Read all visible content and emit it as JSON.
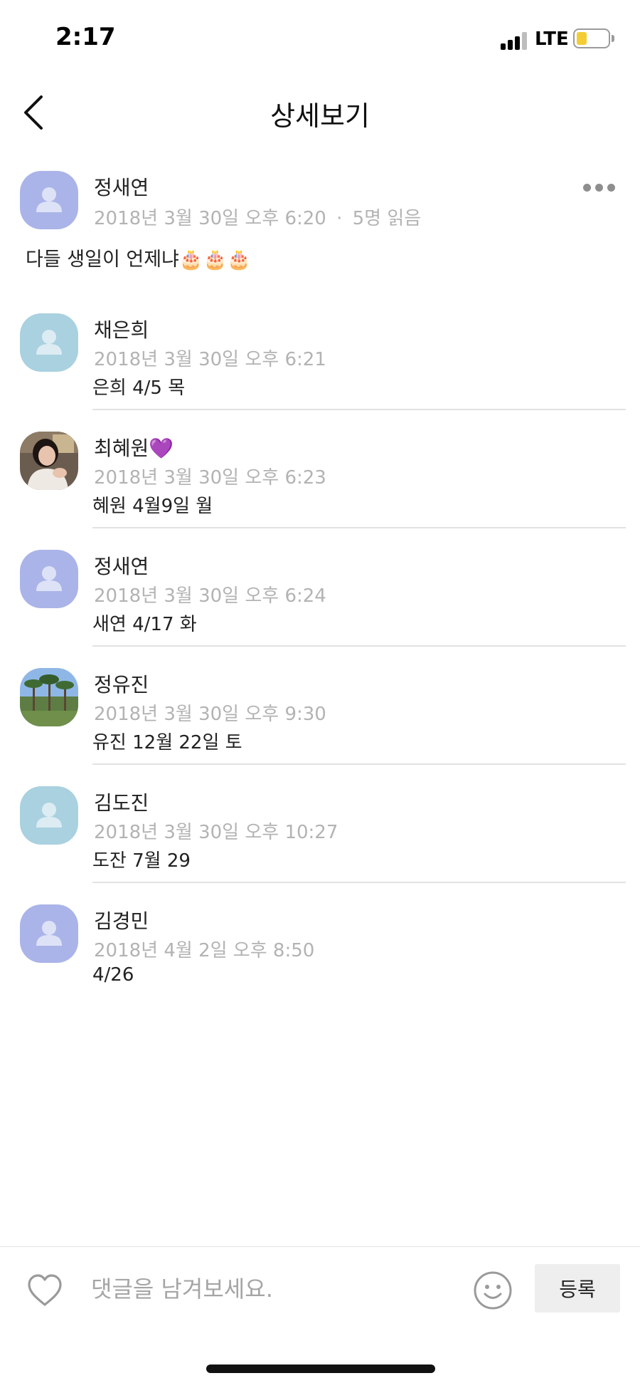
{
  "status_bar": {
    "time": "2:17",
    "network": "LTE",
    "battery_level": 0.3,
    "battery_color": "#f4cd35"
  },
  "header": {
    "title": "상세보기",
    "back_icon": "chevron-left-icon"
  },
  "post": {
    "author": "정새연",
    "timestamp": "2018년 3월 30일 오후 6:20",
    "separator": "·",
    "read_count": "5명 읽음",
    "body": "다들 생일이 언제냐🎂🎂🎂",
    "avatar_color": "#aab4e8",
    "more_icon": "more-horizontal-icon"
  },
  "comments": [
    {
      "name": "채은희",
      "time": "2018년 3월 30일 오후 6:21",
      "text": "은희 4/5 목",
      "avatar": "placeholder-teal"
    },
    {
      "name": "최혜원💜",
      "time": "2018년 3월 30일 오후 6:23",
      "text": "혜원 4월9일 월",
      "avatar": "photo-portrait"
    },
    {
      "name": "정새연",
      "time": "2018년 3월 30일 오후 6:24",
      "text": "새연 4/17 화",
      "avatar": "placeholder-blue"
    },
    {
      "name": "정유진",
      "time": "2018년 3월 30일 오후 9:30",
      "text": "유진 12월 22일 토",
      "avatar": "photo-palm-trees"
    },
    {
      "name": "김도진",
      "time": "2018년 3월 30일 오후 10:27",
      "text": "도잔 7월 29",
      "avatar": "placeholder-teal"
    },
    {
      "name": "김경민",
      "time": "2018년 4월 2일 오후 8:50",
      "text": "4/26",
      "avatar": "placeholder-blue"
    }
  ],
  "input_bar": {
    "placeholder": "댓글을 남겨보세요.",
    "value": "",
    "submit_label": "등록",
    "heart_icon": "heart-outline-icon",
    "emoji_icon": "smiley-icon"
  },
  "colors": {
    "placeholder_blue": "#aab4e8",
    "placeholder_teal": "#a9d1e0",
    "meta_gray": "#b3b3b3",
    "divider": "#e2e2e2"
  }
}
